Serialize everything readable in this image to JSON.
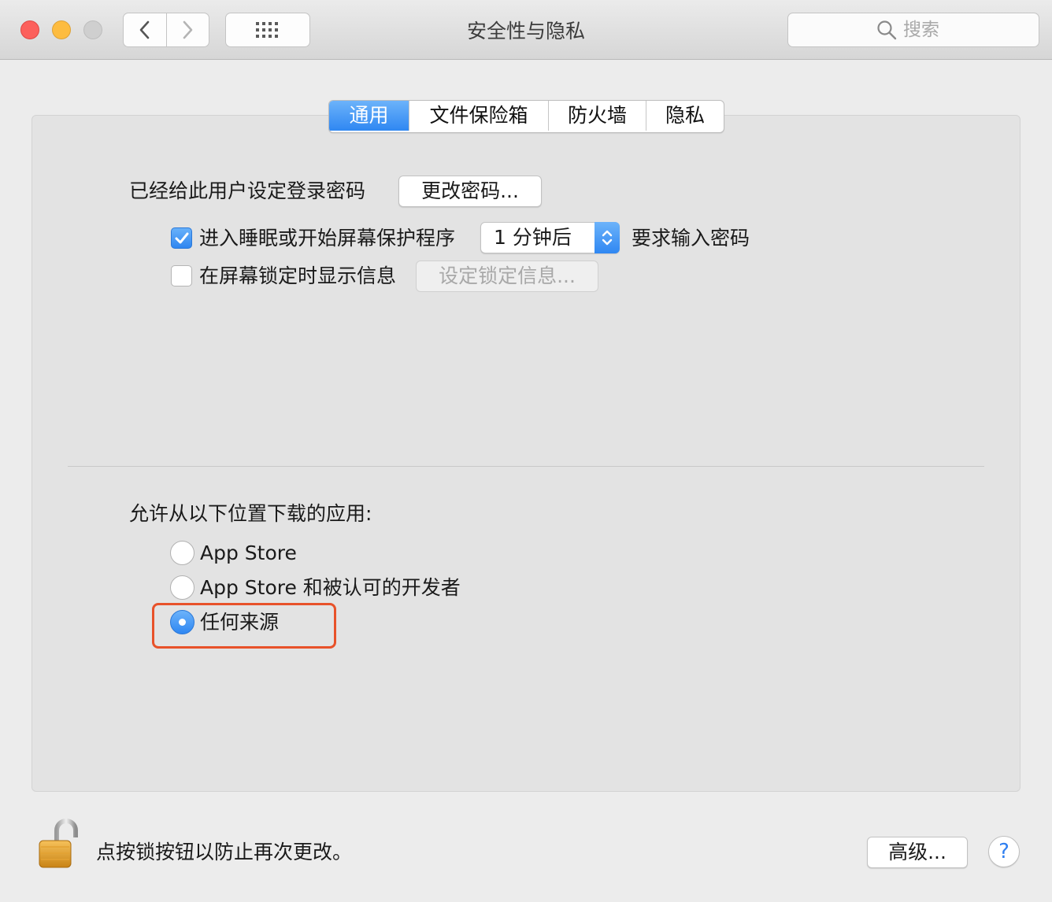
{
  "window": {
    "title": "安全性与隐私"
  },
  "toolbar": {
    "back_icon": "chevron-left-icon",
    "forward_icon": "chevron-right-icon",
    "show_all_icon": "grid-icon",
    "search_placeholder": "搜索"
  },
  "tabs": [
    {
      "label": "通用",
      "active": true
    },
    {
      "label": "文件保险箱",
      "active": false
    },
    {
      "label": "防火墙",
      "active": false
    },
    {
      "label": "隐私",
      "active": false
    }
  ],
  "general": {
    "password_label": "已经给此用户设定登录密码",
    "change_password_button": "更改密码...",
    "sleep_checkbox": {
      "label": "进入睡眠或开始屏幕保护程序",
      "checked": true
    },
    "delay_select": {
      "value": "1 分钟后"
    },
    "require_password_label": "要求输入密码",
    "lock_message_checkbox": {
      "label": "在屏幕锁定时显示信息",
      "checked": false
    },
    "set_lock_message_button": "设定锁定信息..."
  },
  "downloads": {
    "heading": "允许从以下位置下载的应用:",
    "options": [
      {
        "label": "App Store",
        "selected": false
      },
      {
        "label": "App Store 和被认可的开发者",
        "selected": false
      },
      {
        "label": "任何来源",
        "selected": true
      }
    ]
  },
  "footer": {
    "lock_icon": "unlocked-padlock-icon",
    "lock_text": "点按锁按钮以防止再次更改。",
    "advanced_button": "高级...",
    "help_button": "?"
  },
  "colors": {
    "accent": "#2f87f2",
    "highlight_box": "#e8522a",
    "close": "#fc605c",
    "minimize": "#fdbc40",
    "zoom_disabled": "#cfcfcf"
  }
}
